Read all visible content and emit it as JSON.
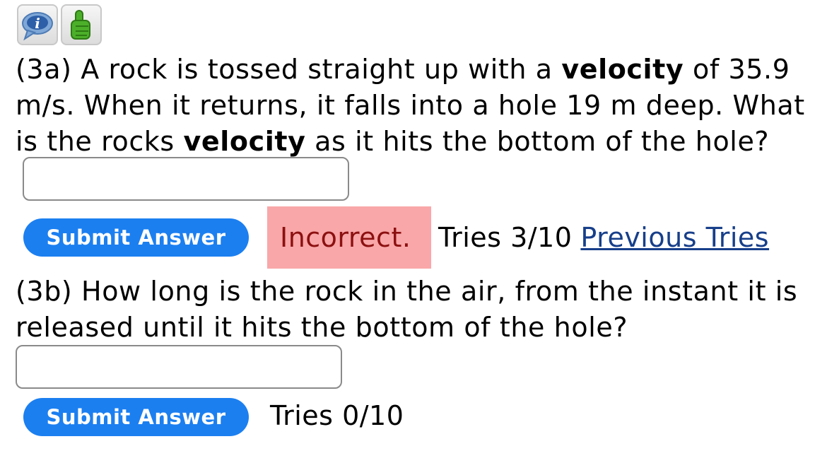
{
  "icons": [
    {
      "name": "info-icon",
      "label": "i"
    },
    {
      "name": "thumbs-up-icon"
    }
  ],
  "q3a": {
    "text_1": "(3a) A rock is tossed straight up with a ",
    "bold_1": "velocity",
    "text_2": " of 35.9 m/s. When it returns, it falls into a hole 19 m deep. What is the rocks ",
    "bold_2": "velocity",
    "text_3": " as it hits the bottom of the hole?",
    "answer_value": "",
    "submit_label": "Submit Answer",
    "status": "Incorrect.",
    "tries": "Tries 3/10",
    "previous_tries": "Previous Tries"
  },
  "q3b": {
    "text": "(3b) How long is the rock in the air, from the instant it is released until it hits the bottom of the hole?",
    "answer_value": "",
    "submit_label": "Submit Answer",
    "tries": "Tries 0/10"
  },
  "colors": {
    "submit_bg": "#1b7ff0",
    "incorrect_bg": "#f9a7a9",
    "incorrect_text": "#8c1010",
    "link": "#173f8a"
  }
}
